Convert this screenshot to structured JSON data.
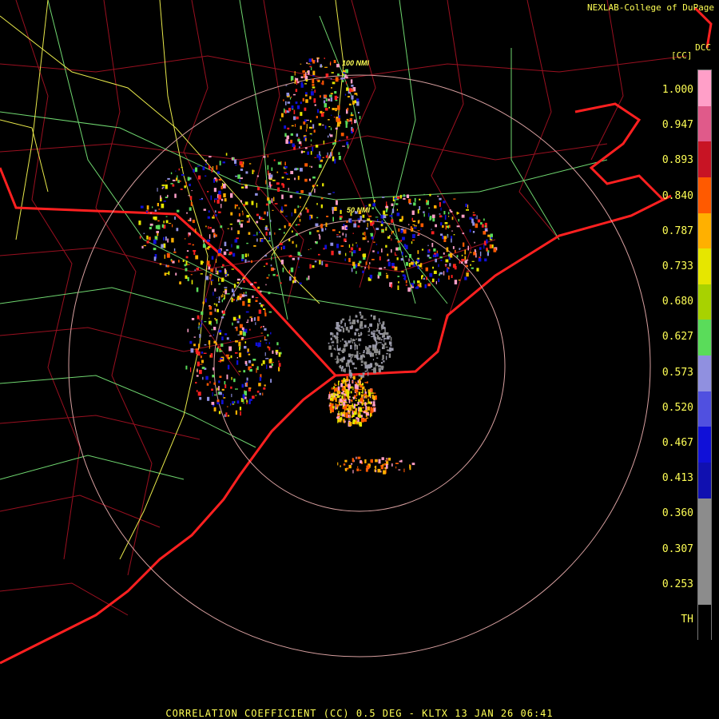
{
  "header": {
    "credit": "NEXLAB-College of DuPage",
    "product_code": "DCC",
    "unit_label": "[CC]"
  },
  "map": {
    "range_rings": [
      {
        "label": "50 NMI"
      },
      {
        "label": "100 NMI"
      }
    ],
    "colors": {
      "background": "#000000",
      "coast_and_state": "#ff2020",
      "county_lines": "#9a1020",
      "highways_green": "#6fd66f",
      "highways_yellow": "#e8e84a",
      "range_ring": "#d8a0a0"
    }
  },
  "color_scale": {
    "labels": [
      "1.000",
      "0.947",
      "0.893",
      "0.840",
      "0.787",
      "0.733",
      "0.680",
      "0.627",
      "0.573",
      "0.520",
      "0.467",
      "0.413",
      "0.360",
      "0.307",
      "0.253",
      "TH"
    ],
    "colors": [
      "#ff9fc8",
      "#e05a8a",
      "#c81424",
      "#ff5a00",
      "#ffb000",
      "#e6e600",
      "#a8d200",
      "#5adc5a",
      "#9090e0",
      "#5050e0",
      "#1010d8",
      "#1010b0",
      "#8c8c8c",
      "#8c8c8c",
      "#8c8c8c",
      "#000000"
    ]
  },
  "footer": {
    "caption": "CORRELATION COEFFICIENT (CC) 0.5 DEG - KLTX 13 JAN 26 06:41"
  }
}
